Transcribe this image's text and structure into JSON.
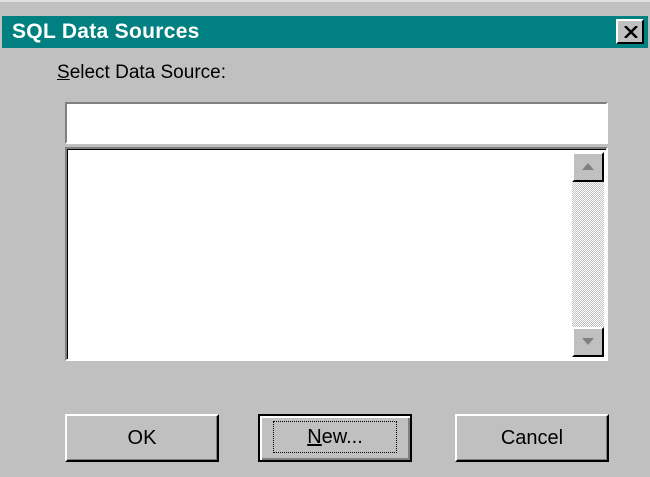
{
  "window": {
    "title": "SQL Data Sources",
    "close_icon": "close-icon"
  },
  "select": {
    "label_mnemonic": "S",
    "label_rest": "elect Data Source:",
    "value": "",
    "items": []
  },
  "scrollbar": {
    "up_icon": "scroll-up-arrow-icon",
    "down_icon": "scroll-down-arrow-icon"
  },
  "buttons": {
    "ok": "OK",
    "new_mnemonic": "N",
    "new_rest": "ew...",
    "cancel": "Cancel"
  },
  "colors": {
    "titlebar": "#008080",
    "face": "#c0c0c0"
  }
}
